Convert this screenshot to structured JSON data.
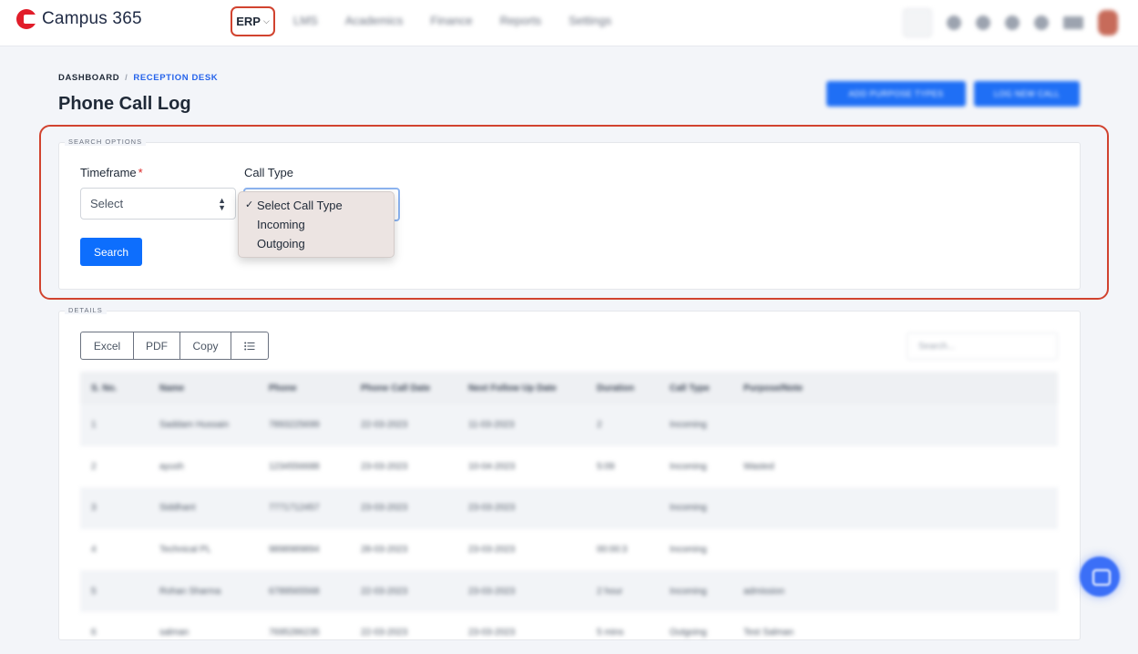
{
  "app": {
    "name": "Campus 365"
  },
  "nav": {
    "erp_label": "ERP",
    "items": [
      "LMS",
      "Academics",
      "Finance",
      "Reports",
      "Settings"
    ]
  },
  "breadcrumb": {
    "root": "DASHBOARD",
    "current": "RECEPTION DESK"
  },
  "page": {
    "title": "Phone Call Log"
  },
  "header_buttons": {
    "primary": "ADD PURPOSE TYPES",
    "secondary": "LOG NEW CALL"
  },
  "search_options": {
    "legend": "SEARCH OPTIONS",
    "timeframe_label": "Timeframe",
    "required_mark": "*",
    "timeframe_value": "Select",
    "calltype_label": "Call Type",
    "calltype_options": [
      "Select Call Type",
      "Incoming",
      "Outgoing"
    ],
    "check_mark": "✓",
    "search_button": "Search"
  },
  "details": {
    "legend": "DETAILS",
    "export_buttons": [
      "Excel",
      "PDF",
      "Copy"
    ],
    "columns_icon": "list-icon",
    "search_placeholder": "Search...",
    "columns": [
      "S. No.",
      "Name",
      "Phone",
      "Phone Call Date",
      "Next Follow Up Date",
      "Duration",
      "Call Type",
      "Purpose/Note"
    ],
    "rows": [
      [
        "1",
        "Saddam Hussain",
        "7893225699",
        "22-03-2023",
        "11-03-2023",
        "2",
        "Incoming",
        ""
      ],
      [
        "2",
        "ayush",
        "1234556688",
        "23-03-2023",
        "10-04-2023",
        "5:09",
        "Incoming",
        "Wasted"
      ],
      [
        "3",
        "Siddhant",
        "7771712457",
        "23-03-2023",
        "23-03-2023",
        "",
        "Incoming",
        ""
      ],
      [
        "4",
        "Technical PL",
        "9898989894",
        "28-03-2023",
        "23-03-2023",
        "00:00:3",
        "Incoming",
        ""
      ],
      [
        "5",
        "Rohan Sharma",
        "6789565568",
        "22-03-2023",
        "23-03-2023",
        "2 hour",
        "Incoming",
        "admission"
      ],
      [
        "6",
        "salman",
        "7695286235",
        "22-03-2023",
        "23-03-2023",
        "5 mins",
        "Outgoing",
        "Test Salman"
      ]
    ]
  }
}
